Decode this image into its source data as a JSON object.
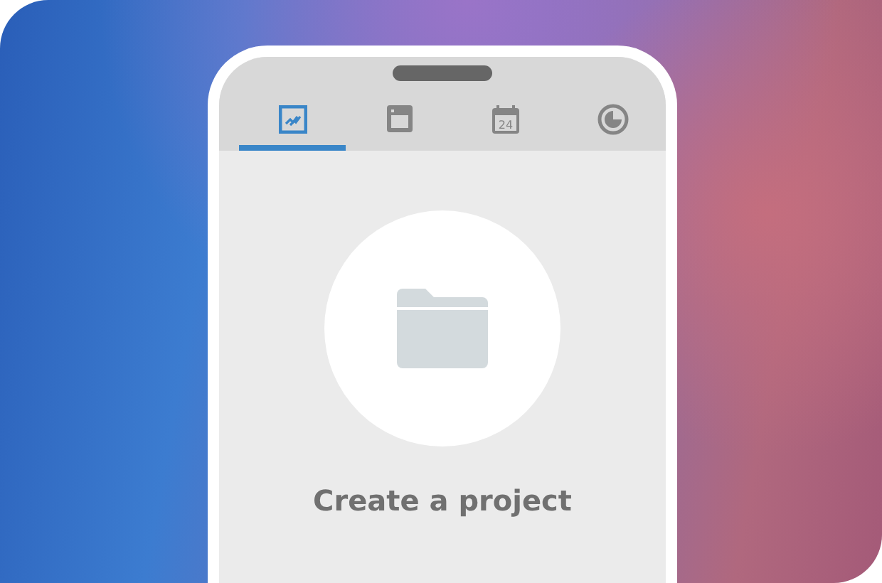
{
  "tabs": [
    {
      "kind": "chart",
      "selected": true
    },
    {
      "kind": "window",
      "selected": false
    },
    {
      "kind": "calendar",
      "selected": false,
      "icon_text": "24"
    },
    {
      "kind": "clock",
      "selected": false
    }
  ],
  "empty_state": {
    "label": "Create a project"
  }
}
